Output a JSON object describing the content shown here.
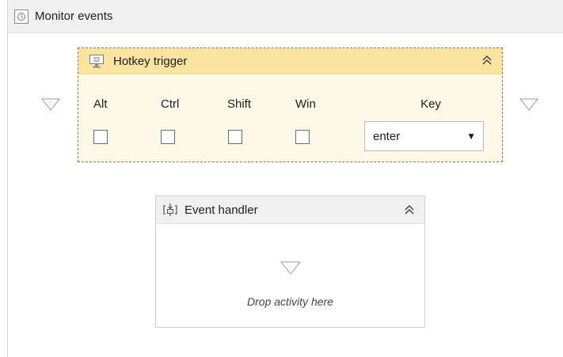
{
  "monitor": {
    "title": "Monitor events",
    "icon": "monitor-events-icon"
  },
  "hotkey_trigger": {
    "title": "Hotkey trigger",
    "icon": "monitor-screen-icon",
    "collapse_icon": "double-chevron-up-icon",
    "modifiers": [
      {
        "label": "Alt",
        "checked": false
      },
      {
        "label": "Ctrl",
        "checked": false
      },
      {
        "label": "Shift",
        "checked": false
      },
      {
        "label": "Win",
        "checked": false
      }
    ],
    "key_label": "Key",
    "key_value": "enter"
  },
  "event_handler": {
    "title": "Event handler",
    "icon": "event-handler-icon",
    "collapse_icon": "double-chevron-up-icon",
    "drop_text": "Drop activity here"
  }
}
